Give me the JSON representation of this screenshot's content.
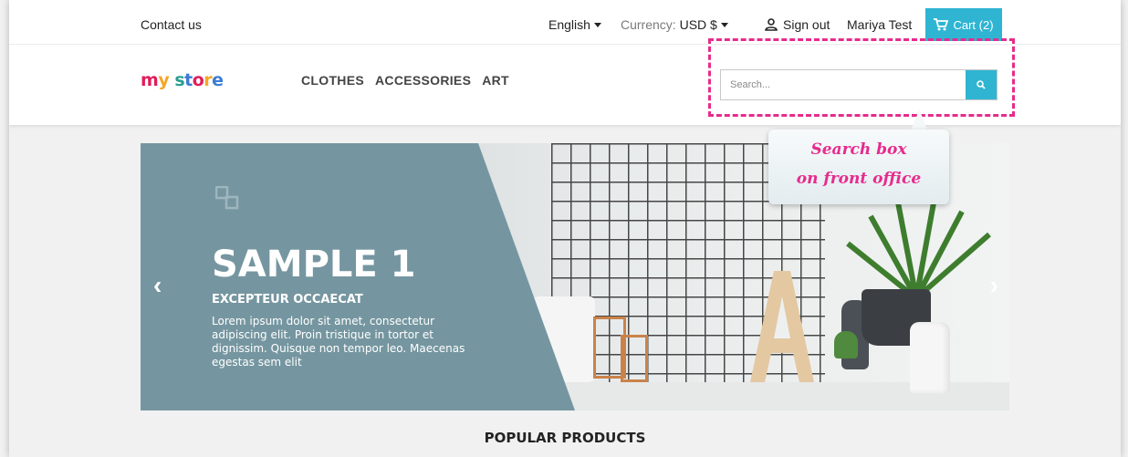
{
  "topbar": {
    "contact": "Contact us",
    "language": "English",
    "currency_label": "Currency:",
    "currency_value": "USD $",
    "signout": "Sign out",
    "username": "Mariya Test",
    "cart": "Cart (2)"
  },
  "header": {
    "logo": {
      "m": "m",
      "y": "y",
      "space": " ",
      "s": "s",
      "t": "t",
      "o": "o",
      "r": "r",
      "e": "e"
    },
    "nav": [
      "CLOTHES",
      "ACCESSORIES",
      "ART"
    ],
    "search_placeholder": "Search..."
  },
  "callout": {
    "line1": "Search box",
    "line2": "on front office"
  },
  "slider": {
    "title": "SAMPLE 1",
    "subtitle": "EXCEPTEUR OCCAECAT",
    "text": "Lorem ipsum dolor sit amet, consectetur adipiscing elit. Proin tristique in tortor et dignissim. Quisque non tempor leo. Maecenas egestas sem elit",
    "prev": "‹",
    "next": "›"
  },
  "section": {
    "popular": "POPULAR PRODUCTS"
  },
  "colors": {
    "accent": "#2fb5d2",
    "highlight": "#e72b8d",
    "panel": "#7596a0"
  }
}
